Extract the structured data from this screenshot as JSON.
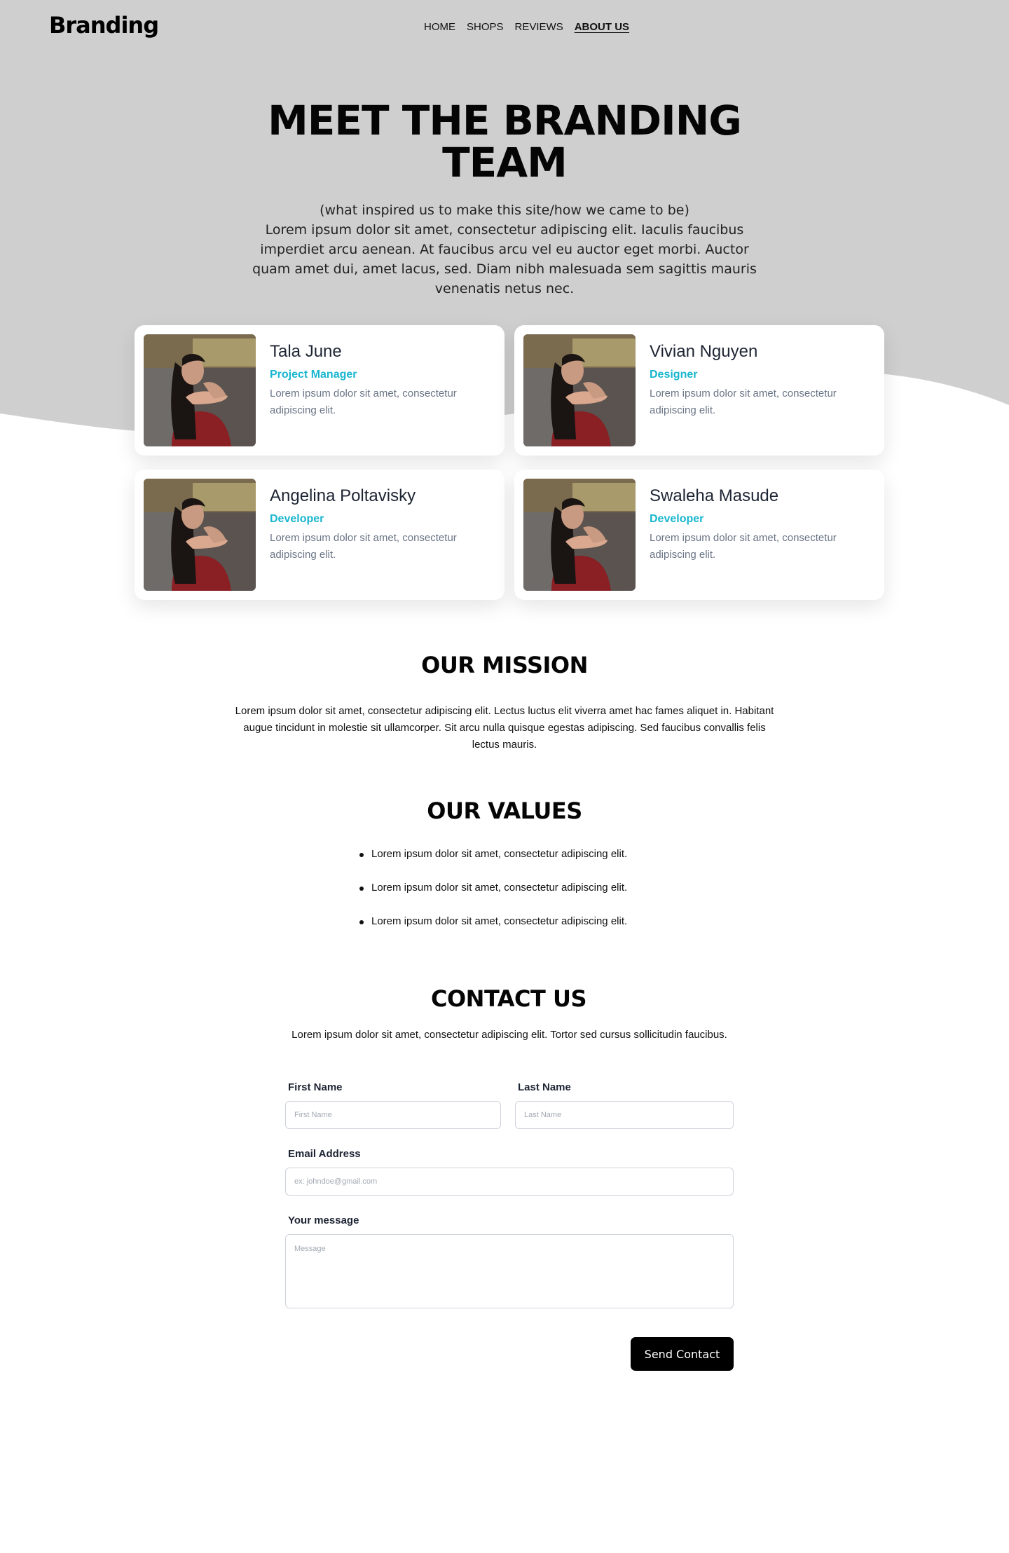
{
  "colors": {
    "hero_background": "#cfcfcf",
    "accent_role": "#19b6cf",
    "button_background": "#000000"
  },
  "header": {
    "logo": "Branding",
    "nav": [
      "HOME",
      "SHOPS",
      "REVIEWS",
      "ABOUT US"
    ],
    "active_nav": "ABOUT US"
  },
  "hero": {
    "title": "MEET THE BRANDING TEAM",
    "subtitle": "(what inspired us to make this site/how we came to be)",
    "text": "Lorem ipsum dolor sit amet, consectetur adipiscing elit. Iaculis faucibus imperdiet arcu aenean. At faucibus arcu vel eu auctor eget morbi. Auctor quam amet dui, amet lacus, sed. Diam nibh malesuada sem sagittis mauris venenatis netus nec."
  },
  "team": [
    {
      "name": "Tala June",
      "role": "Project Manager",
      "description": "Lorem ipsum dolor sit amet, consectetur adipiscing elit."
    },
    {
      "name": "Vivian Nguyen",
      "role": "Designer",
      "description": "Lorem ipsum dolor sit amet, consectetur adipiscing elit."
    },
    {
      "name": "Angelina Poltavisky",
      "role": "Developer",
      "description": "Lorem ipsum dolor sit amet, consectetur adipiscing elit."
    },
    {
      "name": "Swaleha Masude",
      "role": "Developer",
      "description": "Lorem ipsum dolor sit amet, consectetur adipiscing elit."
    }
  ],
  "mission": {
    "title": "OUR MISSION",
    "text": "Lorem ipsum dolor sit amet, consectetur adipiscing elit. Lectus luctus elit viverra amet hac fames aliquet in. Habitant augue tincidunt in molestie sit ullamcorper. Sit arcu nulla quisque egestas adipiscing. Sed faucibus convallis felis lectus mauris."
  },
  "values": {
    "title": "OUR VALUES",
    "items": [
      "Lorem ipsum dolor sit amet, consectetur adipiscing elit.",
      "Lorem ipsum dolor sit amet, consectetur adipiscing elit.",
      "Lorem ipsum dolor sit amet, consectetur adipiscing elit."
    ]
  },
  "contact": {
    "title": "CONTACT US",
    "text": "Lorem ipsum dolor sit amet, consectetur adipiscing elit. Tortor sed cursus sollicitudin faucibus.",
    "first_name": {
      "label": "First Name",
      "placeholder": "First Name",
      "value": ""
    },
    "last_name": {
      "label": "Last Name",
      "placeholder": "Last Name",
      "value": ""
    },
    "email": {
      "label": "Email Address",
      "placeholder": "ex: johndoe@gmail.com",
      "value": ""
    },
    "message": {
      "label": "Your message",
      "placeholder": "Message",
      "value": ""
    },
    "submit_label": "Send Contact"
  }
}
